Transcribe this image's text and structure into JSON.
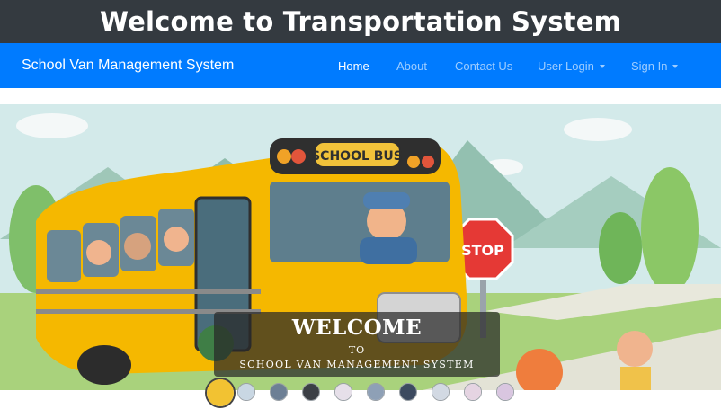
{
  "page": {
    "banner_title": "Welcome to Transportation System"
  },
  "navbar": {
    "brand": "School Van Management System",
    "links": [
      {
        "label": "Home"
      },
      {
        "label": "About"
      },
      {
        "label": "Contact Us"
      },
      {
        "label": "User Login"
      },
      {
        "label": "Sign In"
      }
    ]
  },
  "hero": {
    "sign_bus": "SCHOOL BUS",
    "sign_stop": "STOP",
    "caption_title": "WELCOME",
    "caption_to": "TO",
    "caption_subtitle": "SCHOOL VAN MANAGEMENT SYSTEM"
  },
  "carousel": {
    "active_index": 0,
    "thumbnails": [
      {
        "color": "#f2c232"
      },
      {
        "color": "#c9d7e3"
      },
      {
        "color": "#6d7f95"
      },
      {
        "color": "#3b3f45"
      },
      {
        "color": "#e6dfe9"
      },
      {
        "color": "#8ea0b6"
      },
      {
        "color": "#3c4a60"
      },
      {
        "color": "#d2d9e3"
      },
      {
        "color": "#e5d4e2"
      },
      {
        "color": "#d9c6e0"
      }
    ]
  },
  "colors": {
    "banner_bg": "#343a40",
    "navbar_bg": "#007bff",
    "bus_yellow": "#f5b800",
    "stop_red": "#e53935"
  }
}
